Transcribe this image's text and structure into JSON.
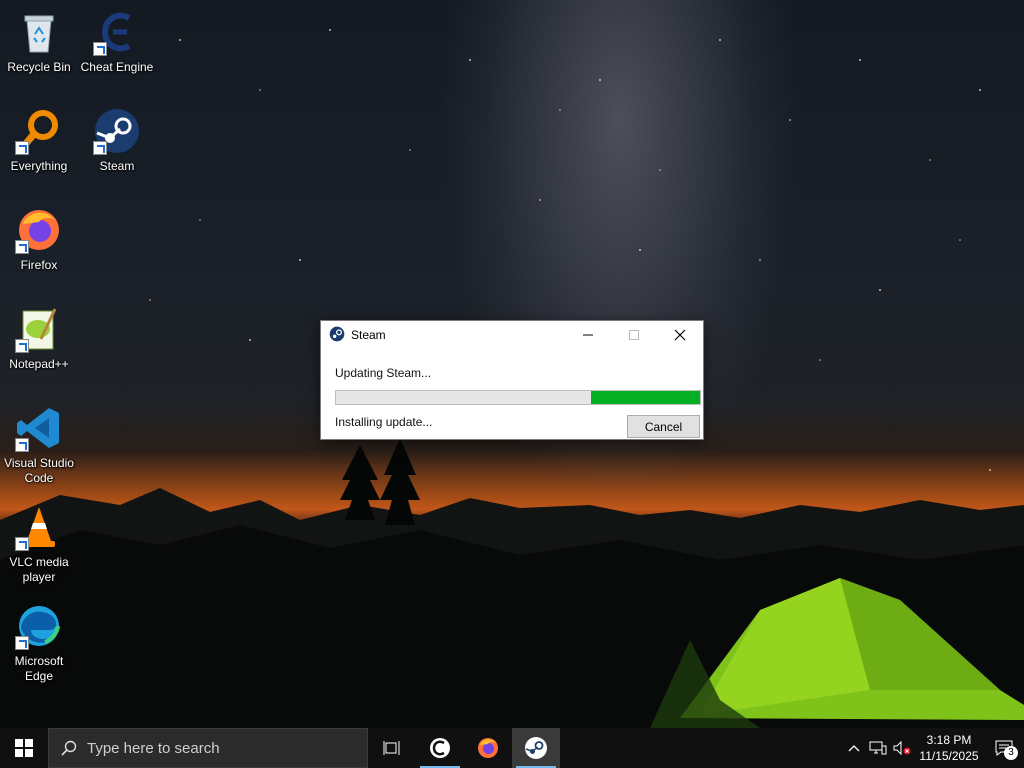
{
  "desktop": {
    "icons": [
      {
        "label": "Recycle Bin"
      },
      {
        "label": "Cheat Engine"
      },
      {
        "label": "Everything"
      },
      {
        "label": "Steam"
      },
      {
        "label": "Firefox"
      },
      {
        "label": "Notepad++"
      },
      {
        "label": "Visual Studio Code"
      },
      {
        "label": "VLC media player"
      },
      {
        "label": "Microsoft Edge"
      }
    ]
  },
  "dialog": {
    "title": "Steam",
    "message": "Updating Steam...",
    "progress": 0.3,
    "status": "Installing update...",
    "cancel_label": "Cancel"
  },
  "taskbar": {
    "search_placeholder": "Type here to search",
    "time": "3:18 PM",
    "date": "11/15/2025",
    "notification_count": "3",
    "accent": "#76b9ed"
  }
}
